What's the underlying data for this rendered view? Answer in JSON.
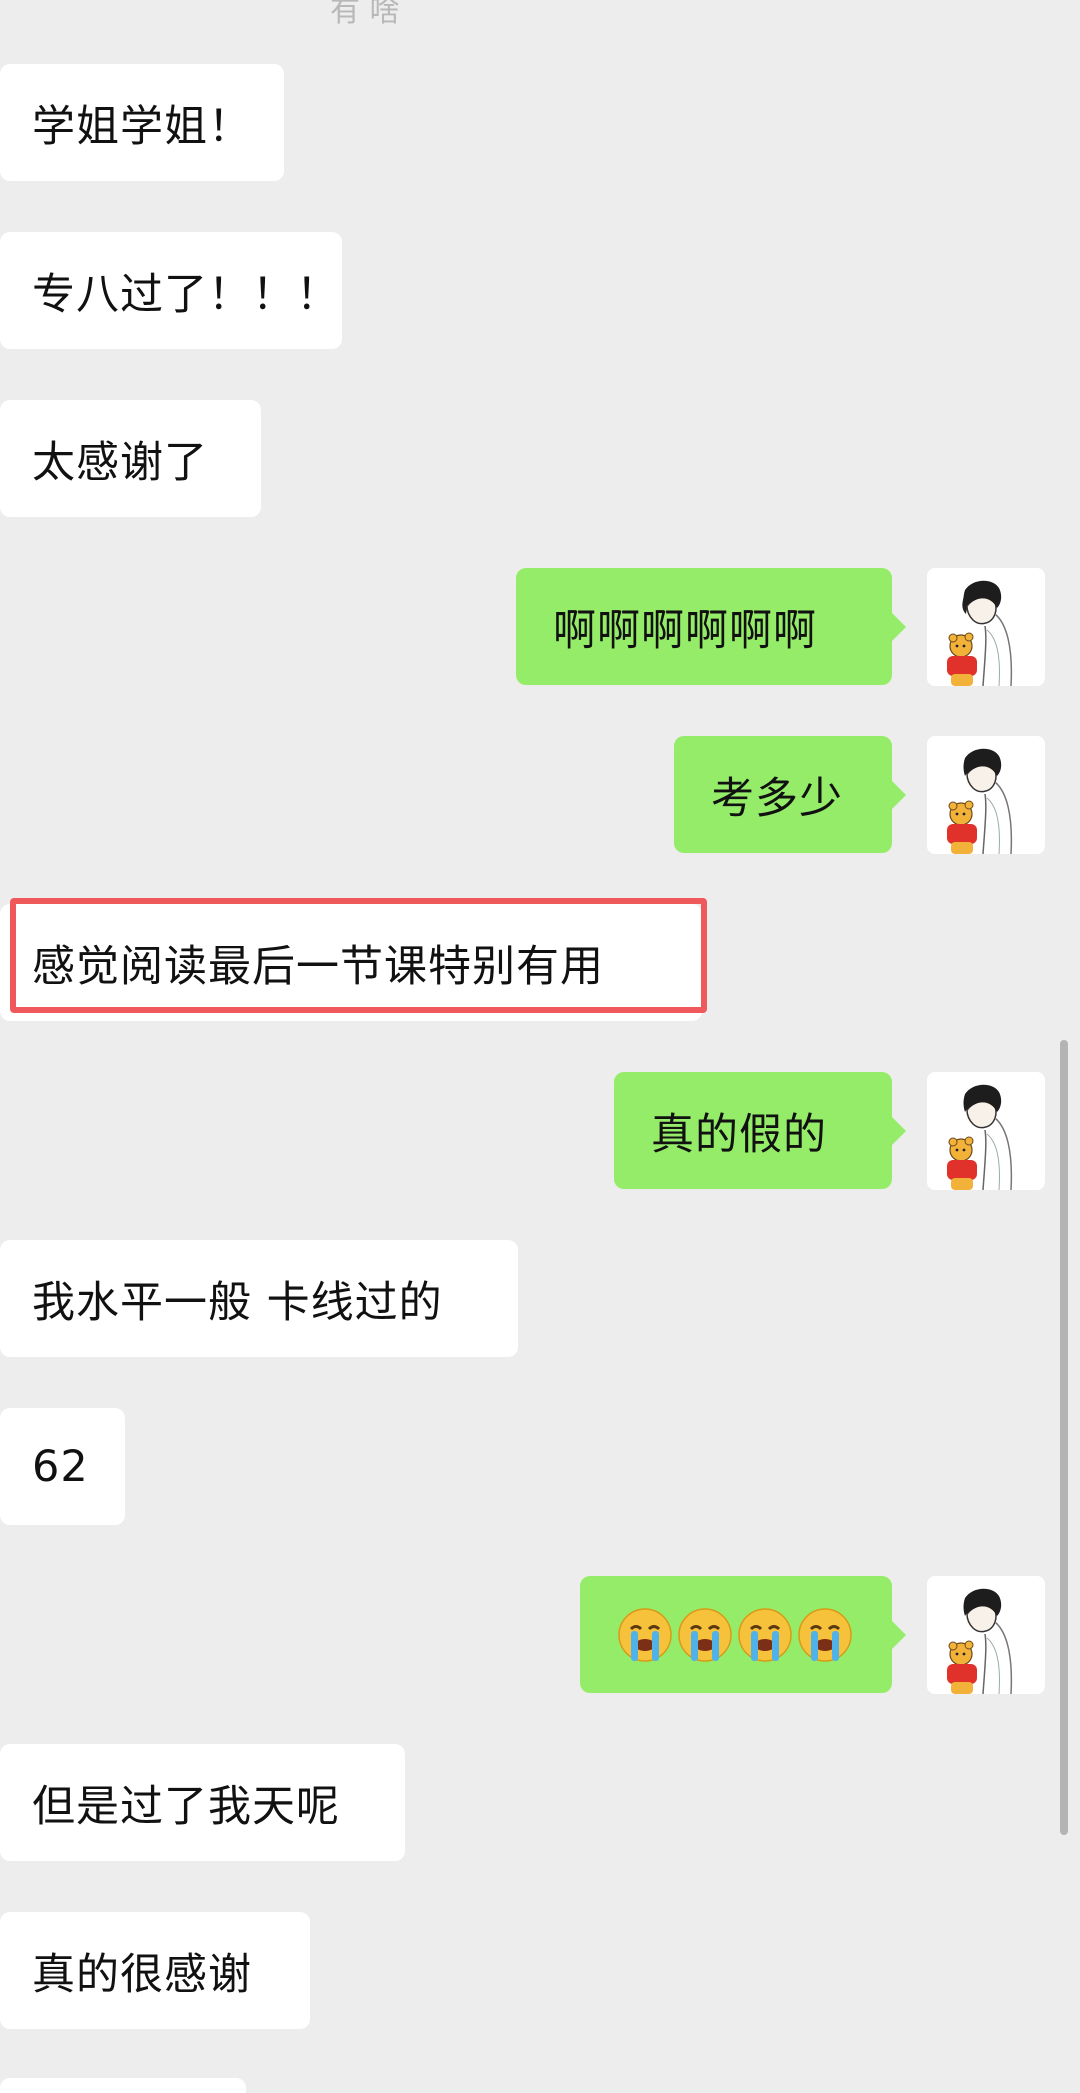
{
  "top_fragment": "有 啥",
  "messages": [
    {
      "side": "recv",
      "text": "学姐学姐！"
    },
    {
      "side": "recv",
      "text": "专八过了！！！"
    },
    {
      "side": "recv",
      "text": "太感谢了"
    },
    {
      "side": "sent",
      "text": "啊啊啊啊啊啊"
    },
    {
      "side": "sent",
      "text": "考多少"
    },
    {
      "side": "recv",
      "text": "感觉阅读最后一节课特别有用",
      "highlighted": true
    },
    {
      "side": "sent",
      "text": "真的假的"
    },
    {
      "side": "recv",
      "text": "我水平一般 卡线过的"
    },
    {
      "side": "recv",
      "text": "62"
    },
    {
      "side": "sent",
      "emoji": "crying-face",
      "emoji_count": 4
    },
    {
      "side": "recv",
      "text": "但是过了我天呢"
    },
    {
      "side": "recv",
      "text": "真的很感谢"
    }
  ],
  "avatar": {
    "icon": "boy-with-winnie-the-pooh-avatar-icon"
  },
  "colors": {
    "background": "#ededed",
    "received_bubble": "#ffffff",
    "sent_bubble": "#95ec69",
    "highlight_border": "#f0595c"
  }
}
